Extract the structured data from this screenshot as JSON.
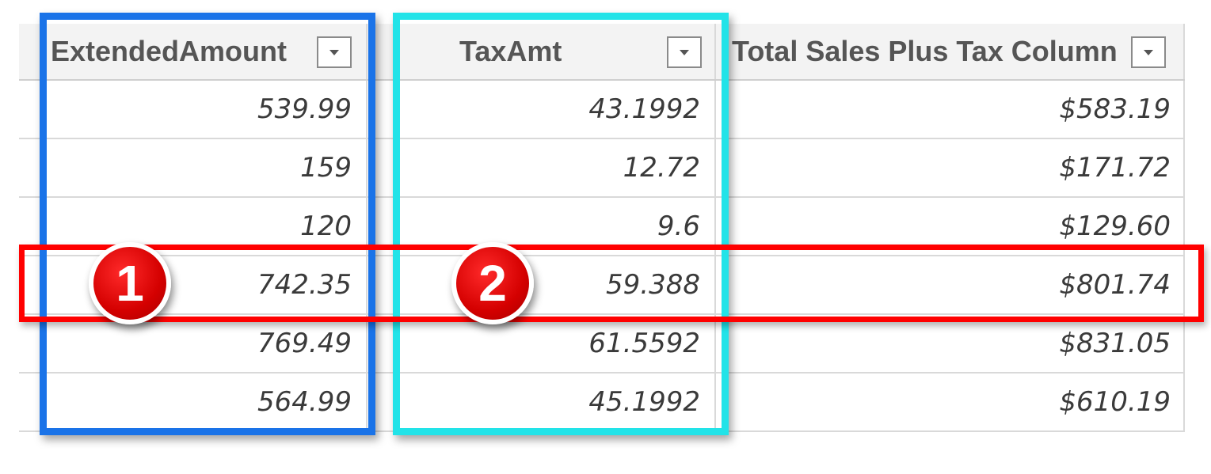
{
  "columns": [
    {
      "header": "ExtendedAmount"
    },
    {
      "header": "TaxAmt"
    },
    {
      "header": "Total Sales Plus Tax Column"
    }
  ],
  "rows": [
    [
      "539.99",
      "43.1992",
      "$583.19"
    ],
    [
      "159",
      "12.72",
      "$171.72"
    ],
    [
      "120",
      "9.6",
      "$129.60"
    ],
    [
      "742.35",
      "59.388",
      "$801.74"
    ],
    [
      "769.49",
      "61.5592",
      "$831.05"
    ],
    [
      "564.99",
      "45.1992",
      "$610.19"
    ]
  ],
  "highlights": {
    "column_1_color": "#1a73e8",
    "column_2_color": "#22e3e8",
    "row_color": "#ff0000",
    "badge_color": "#e00000"
  },
  "badges": [
    {
      "label": "1"
    },
    {
      "label": "2"
    }
  ]
}
